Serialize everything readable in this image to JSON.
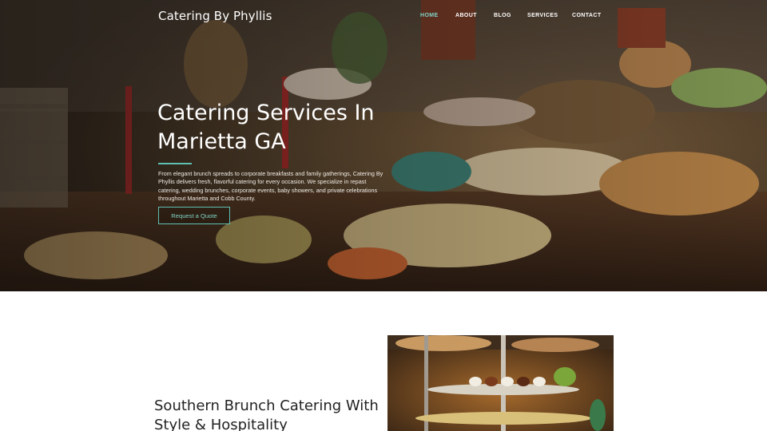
{
  "header": {
    "brand": "Catering By Phyllis",
    "nav": [
      {
        "label": "HOME",
        "active": true
      },
      {
        "label": "ABOUT",
        "active": false
      },
      {
        "label": "BLOG",
        "active": false
      },
      {
        "label": "SERVICES",
        "active": false
      },
      {
        "label": "CONTACT",
        "active": false
      }
    ]
  },
  "hero": {
    "title": "Catering Services In Marietta GA",
    "description": "From elegant brunch spreads to corporate breakfasts and family gatherings, Catering By Phyllis delivers fresh, flavorful catering for every occasion. We specialize in repast catering, wedding brunches, corporate events, baby showers, and private celebrations throughout Marietta and Cobb County.",
    "cta_label": "Request a Quote"
  },
  "section2": {
    "title": "Southern Brunch Catering With Style & Hospitality"
  },
  "colors": {
    "accent": "#5fbfb0",
    "nav_active": "#7fd3c5"
  }
}
